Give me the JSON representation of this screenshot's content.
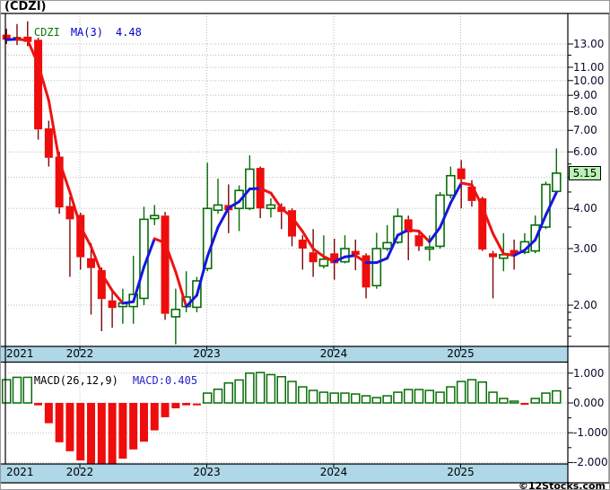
{
  "window": {
    "title": "(CDZI)"
  },
  "legend": {
    "symbol": "CDZI",
    "ma_label": "MA(3)",
    "ma_value": "4.48"
  },
  "macd_panel": {
    "label": "MACD(26,12,9)",
    "value_label": "MACD:0.405"
  },
  "footer": {
    "copyright": "©12Stocks.com"
  },
  "price_axis": {
    "labels": [
      {
        "text": "13.00",
        "v": 13
      },
      {
        "text": "11.00",
        "v": 11
      },
      {
        "text": "10.00",
        "v": 10
      },
      {
        "text": "9.00",
        "v": 9
      },
      {
        "text": "8.00",
        "v": 8
      },
      {
        "text": "7.00",
        "v": 7
      },
      {
        "text": "6.00",
        "v": 6
      },
      {
        "text": "4.00",
        "v": 4
      },
      {
        "text": "3.00",
        "v": 3
      },
      {
        "text": "2.00",
        "v": 2
      }
    ],
    "gridlines": [
      13,
      12,
      11,
      10,
      9,
      8,
      7,
      6,
      5,
      4,
      3,
      2
    ],
    "minor_ticks": [
      12,
      5.5,
      5,
      4.5,
      3.5,
      2.5,
      1.9,
      1.8,
      1.7,
      1.6
    ],
    "current_price": "5.15",
    "current_price_value": 5.15
  },
  "macd_axis": {
    "labels": [
      {
        "text": "1.000",
        "v": 1
      },
      {
        "text": "0.000",
        "v": 0
      },
      {
        "text": "-1.000",
        "v": -1
      },
      {
        "text": "-2.000",
        "v": -2
      }
    ],
    "minor_ticks": [
      0.5,
      -0.5,
      -1.5
    ]
  },
  "x_axis": {
    "years": [
      "2021",
      "2022",
      "2023",
      "2024",
      "2025"
    ]
  },
  "colors": {
    "up": "#066d06",
    "down": "#ee0c0c",
    "down_wick": "#7d0505",
    "ma_up": "#1616dd",
    "ma_down": "#ef1212",
    "year_bar": "#aed7e7",
    "flag_bg": "#b9f2b4",
    "grid": "#bbbbbb",
    "frame": "#000000"
  },
  "chart_data": {
    "type": "candlestick",
    "symbol": "CDZI",
    "scale": "log",
    "ma_period": 3,
    "ma_last": 4.48,
    "macd_params": "26,12,9",
    "macd_last": 0.405,
    "price_range": [
      1.5,
      15.5
    ],
    "macd_range": [
      -2.17,
      1.36
    ],
    "months": [
      "2021-06",
      "2021-07",
      "2021-08",
      "2021-09",
      "2021-10",
      "2021-11",
      "2021-12",
      "2022-01",
      "2022-02",
      "2022-03",
      "2022-04",
      "2022-05",
      "2022-06",
      "2022-07",
      "2022-08",
      "2022-09",
      "2022-10",
      "2022-11",
      "2022-12",
      "2023-01",
      "2023-02",
      "2023-03",
      "2023-04",
      "2023-05",
      "2023-06",
      "2023-07",
      "2023-08",
      "2023-09",
      "2023-10",
      "2023-11",
      "2023-12",
      "2024-01",
      "2024-02",
      "2024-03",
      "2024-04",
      "2024-05",
      "2024-06",
      "2024-07",
      "2024-08",
      "2024-09",
      "2024-10",
      "2024-11",
      "2024-12",
      "2025-01",
      "2025-02",
      "2025-03",
      "2025-04",
      "2025-05",
      "2025-06",
      "2025-07",
      "2025-08",
      "2025-09",
      "2025-10"
    ],
    "ohlc": [
      [
        13.9,
        14.5,
        13.0,
        13.4
      ],
      [
        13.65,
        15.0,
        12.9,
        13.5
      ],
      [
        13.7,
        15.3,
        12.8,
        13.2
      ],
      [
        13.4,
        13.6,
        6.55,
        7.05
      ],
      [
        7.1,
        7.5,
        5.4,
        5.75
      ],
      [
        5.8,
        6.0,
        3.85,
        4.03
      ],
      [
        4.07,
        4.35,
        2.45,
        3.7
      ],
      [
        3.82,
        3.88,
        2.58,
        2.82
      ],
      [
        2.8,
        3.12,
        1.87,
        2.61
      ],
      [
        2.57,
        2.62,
        1.66,
        2.09
      ],
      [
        2.07,
        2.2,
        1.7,
        1.96
      ],
      [
        1.98,
        2.25,
        1.75,
        2.03
      ],
      [
        1.98,
        2.85,
        1.75,
        2.16
      ],
      [
        2.1,
        4.05,
        2.0,
        3.7
      ],
      [
        3.72,
        4.1,
        3.55,
        3.8
      ],
      [
        3.8,
        3.9,
        1.8,
        1.88
      ],
      [
        1.84,
        2.25,
        1.51,
        1.94
      ],
      [
        1.98,
        2.55,
        1.9,
        2.12
      ],
      [
        1.97,
        2.45,
        1.9,
        2.38
      ],
      [
        2.6,
        5.55,
        2.55,
        4.0
      ],
      [
        3.95,
        4.95,
        3.85,
        4.1
      ],
      [
        4.1,
        4.75,
        3.35,
        3.95
      ],
      [
        4.0,
        4.72,
        3.4,
        4.55
      ],
      [
        4.0,
        5.85,
        3.95,
        5.3
      ],
      [
        5.35,
        5.4,
        3.73,
        4.0
      ],
      [
        4.0,
        4.3,
        3.75,
        4.1
      ],
      [
        4.05,
        4.15,
        3.45,
        3.9
      ],
      [
        3.95,
        4.0,
        3.05,
        3.27
      ],
      [
        3.2,
        3.3,
        2.58,
        3.0
      ],
      [
        2.92,
        3.45,
        2.45,
        2.72
      ],
      [
        2.65,
        3.3,
        2.6,
        2.78
      ],
      [
        2.9,
        3.22,
        2.4,
        2.7
      ],
      [
        2.73,
        3.3,
        2.7,
        3.0
      ],
      [
        2.95,
        3.2,
        2.57,
        2.87
      ],
      [
        2.86,
        2.9,
        2.1,
        2.27
      ],
      [
        2.3,
        3.36,
        2.25,
        3.0
      ],
      [
        3.0,
        3.55,
        2.95,
        3.13
      ],
      [
        3.14,
        4.0,
        3.1,
        3.78
      ],
      [
        3.7,
        3.8,
        2.76,
        3.37
      ],
      [
        3.3,
        3.4,
        2.95,
        3.05
      ],
      [
        2.99,
        3.3,
        2.75,
        3.03
      ],
      [
        3.05,
        4.5,
        3.0,
        4.4
      ],
      [
        4.4,
        5.4,
        4.3,
        5.06
      ],
      [
        5.33,
        5.66,
        4.0,
        4.93
      ],
      [
        4.68,
        4.9,
        4.05,
        4.22
      ],
      [
        4.3,
        4.35,
        2.95,
        2.98
      ],
      [
        2.9,
        2.95,
        2.1,
        2.82
      ],
      [
        2.8,
        3.35,
        2.55,
        2.87
      ],
      [
        2.97,
        3.2,
        2.58,
        2.88
      ],
      [
        2.92,
        3.35,
        2.88,
        3.15
      ],
      [
        2.95,
        3.8,
        2.9,
        3.55
      ],
      [
        3.5,
        4.85,
        3.45,
        4.75
      ],
      [
        4.52,
        6.15,
        4.45,
        5.15
      ]
    ],
    "macd": [
      0.78,
      0.86,
      0.86,
      -0.08,
      -0.68,
      -1.32,
      -1.62,
      -1.93,
      -2.05,
      -2.1,
      -2.05,
      -1.87,
      -1.56,
      -1.3,
      -0.92,
      -0.48,
      -0.18,
      -0.08,
      -0.05,
      0.33,
      0.46,
      0.67,
      0.77,
      1.0,
      1.02,
      0.95,
      0.88,
      0.72,
      0.54,
      0.42,
      0.36,
      0.33,
      0.33,
      0.3,
      0.24,
      0.18,
      0.24,
      0.36,
      0.45,
      0.45,
      0.42,
      0.36,
      0.54,
      0.72,
      0.78,
      0.7,
      0.36,
      0.15,
      0.06,
      -0.03,
      0.15,
      0.33,
      0.405
    ]
  }
}
